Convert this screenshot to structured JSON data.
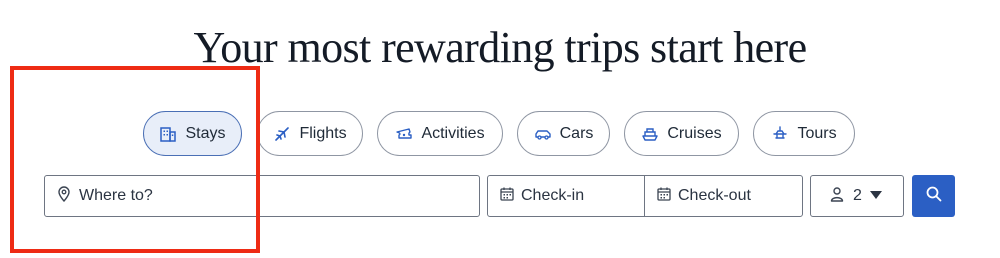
{
  "headline": "Your most rewarding trips start here",
  "tabs": [
    {
      "label": "Stays",
      "icon": "building-icon",
      "active": true
    },
    {
      "label": "Flights",
      "icon": "airplane-icon",
      "active": false
    },
    {
      "label": "Activities",
      "icon": "ticket-icon",
      "active": false
    },
    {
      "label": "Cars",
      "icon": "car-icon",
      "active": false
    },
    {
      "label": "Cruises",
      "icon": "ship-icon",
      "active": false
    },
    {
      "label": "Tours",
      "icon": "tour-icon",
      "active": false
    }
  ],
  "search": {
    "destination_placeholder": "Where to?",
    "checkin_placeholder": "Check-in",
    "checkout_placeholder": "Check-out",
    "guests_count": "2"
  },
  "colors": {
    "accent": "#2b5fc4",
    "active_tab_bg": "#e8eef9",
    "highlight": "#ee2b14"
  }
}
